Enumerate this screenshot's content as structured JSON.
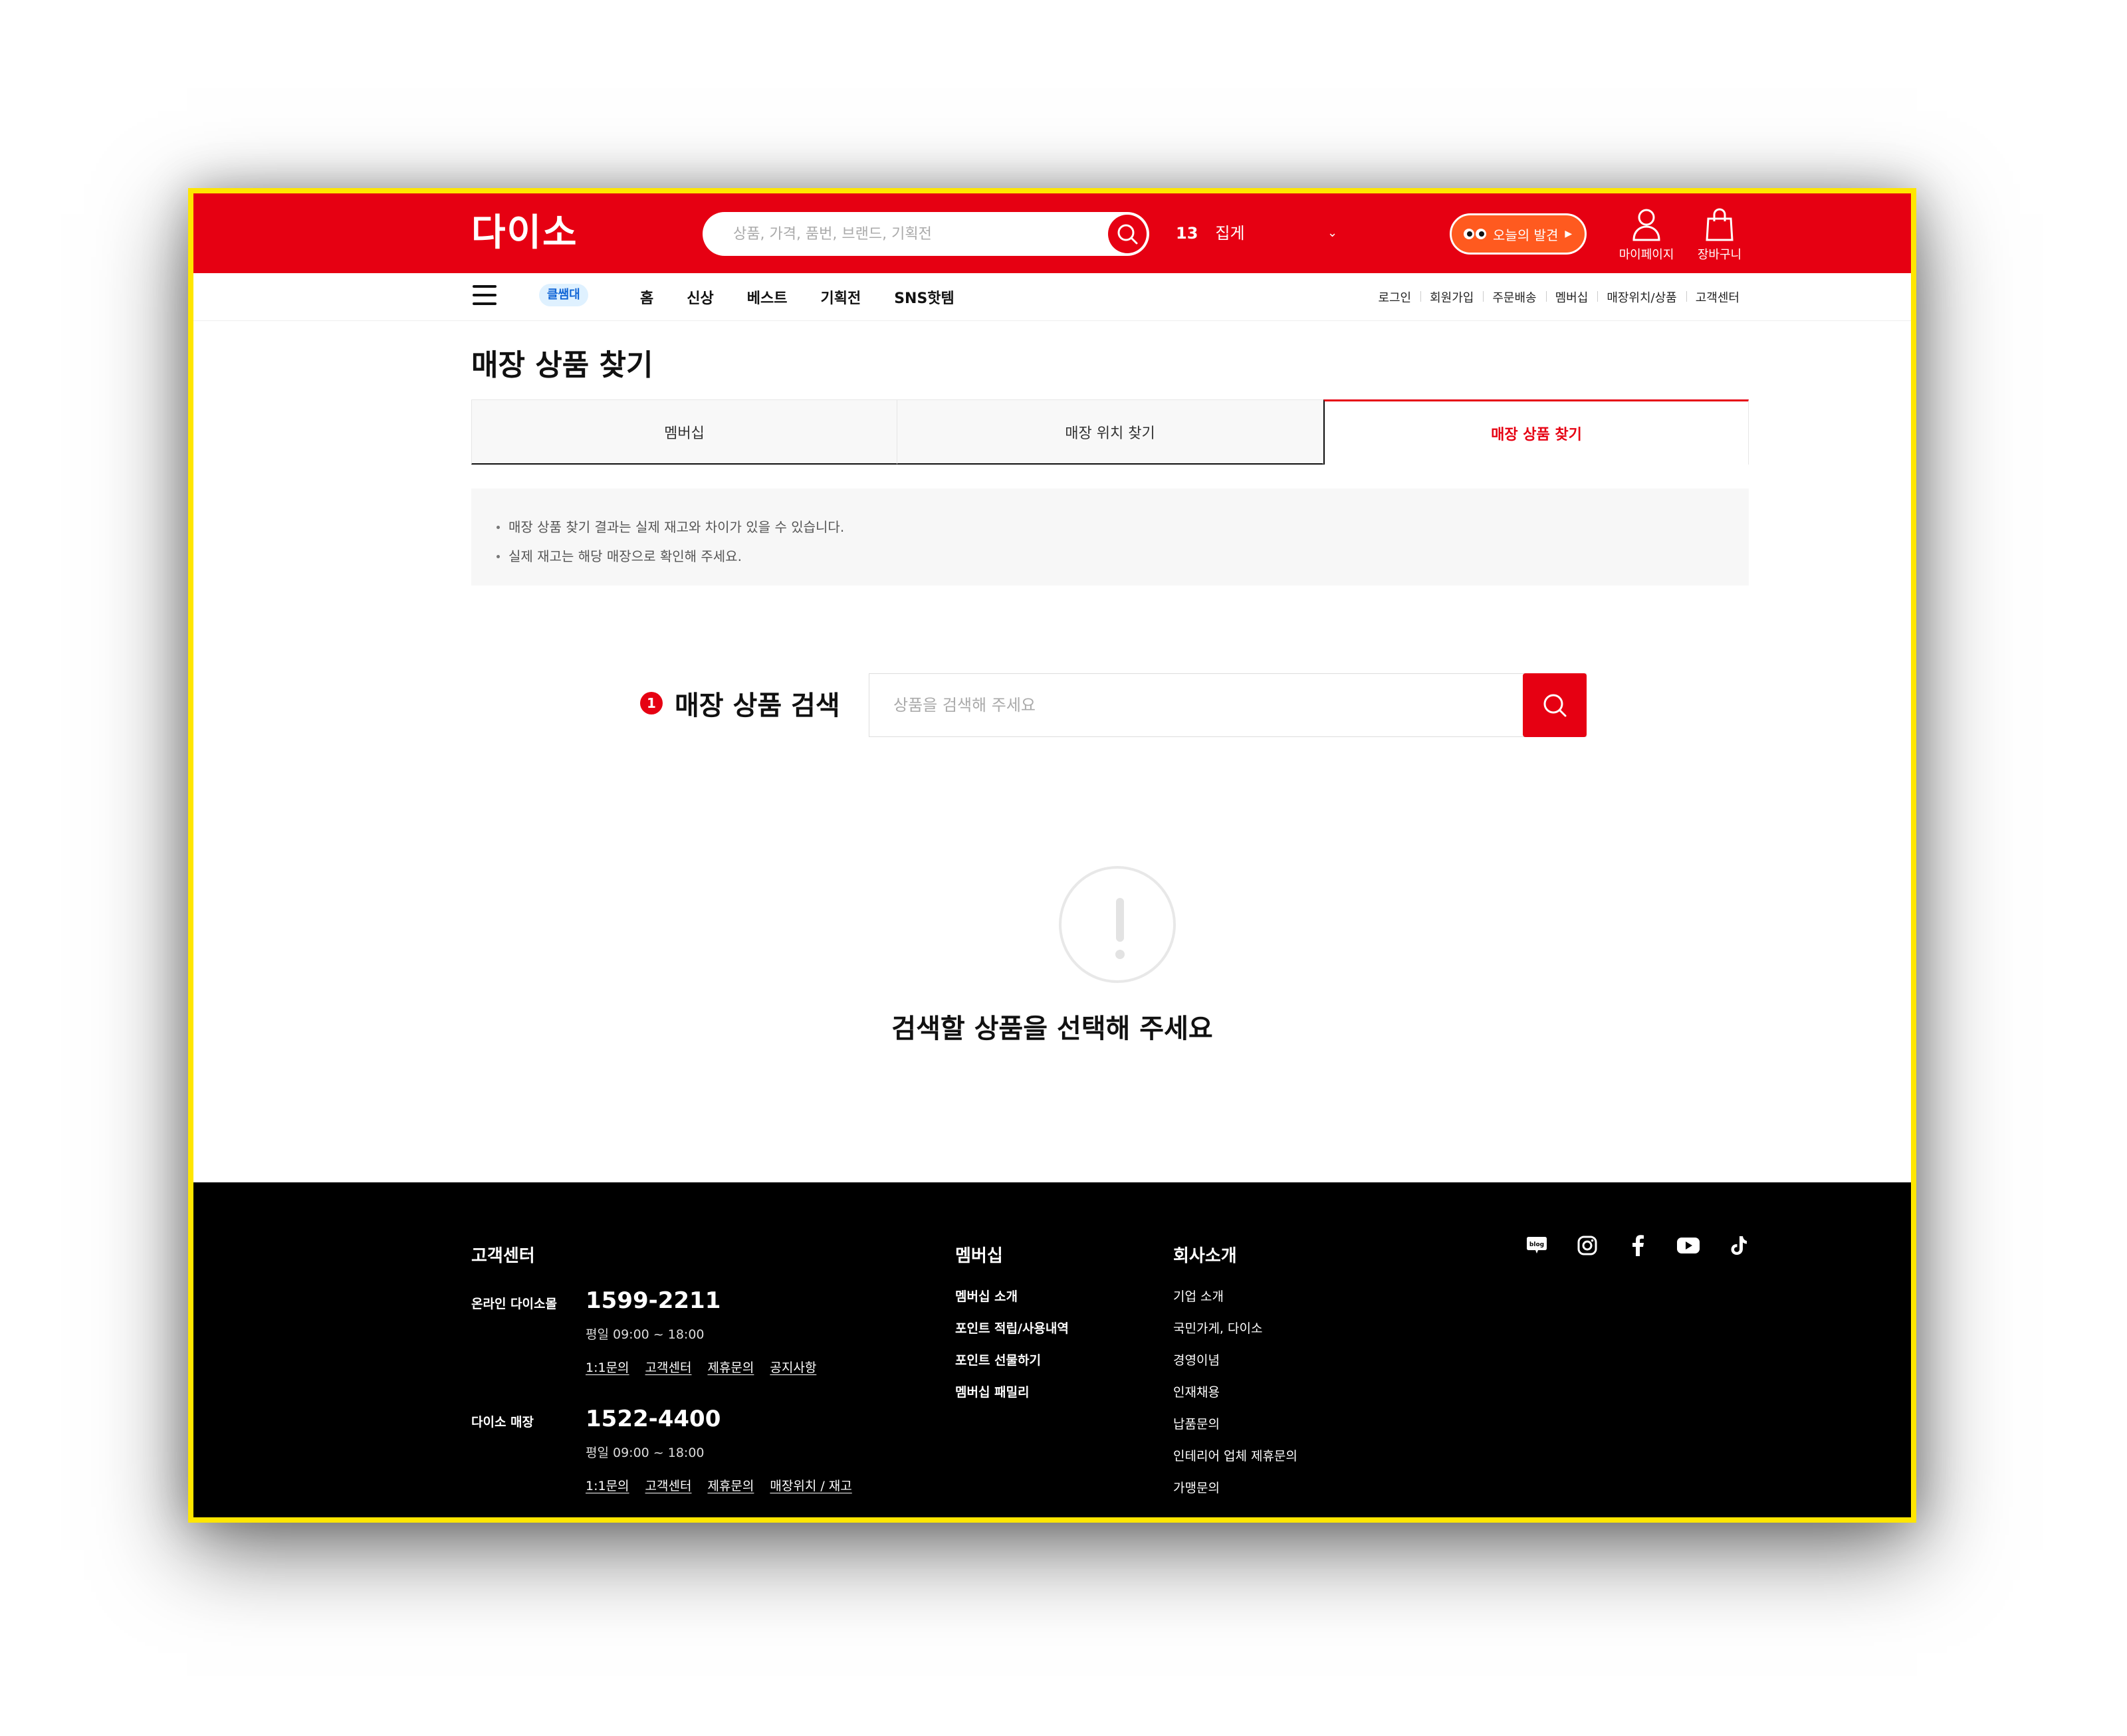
{
  "header": {
    "logo": "다이소",
    "search_placeholder": "상품, 가격, 품번, 브랜드, 기획전",
    "ranking": {
      "rank": "13",
      "term": "집게"
    },
    "promo_label": "오늘의 발견",
    "mypage_label": "마이페이지",
    "cart_label": "장바구니",
    "brand_color": "#e60012"
  },
  "nav": {
    "badge": "클쌤대",
    "items": [
      "홈",
      "신상",
      "베스트",
      "기획전",
      "SNS핫템"
    ],
    "util_items": [
      "로그인",
      "회원가입",
      "주문배송",
      "멤버십",
      "매장위치/상품",
      "고객센터"
    ]
  },
  "page": {
    "title": "매장 상품 찾기",
    "tabs": [
      "멤버십",
      "매장 위치 찾기",
      "매장 상품 찾기"
    ],
    "active_tab": "매장 상품 찾기",
    "notices": [
      "매장 상품 찾기 결과는 실제 재고와 차이가 있을 수 있습니다.",
      "실제 재고는 해당 매장으로 확인해 주세요."
    ],
    "step_number": "1",
    "step_label": "매장 상품 검색",
    "product_search_placeholder": "상품을 검색해 주세요",
    "empty_message": "검색할 상품을 선택해 주세요"
  },
  "footer": {
    "cs_title": "고객센터",
    "online": {
      "label": "온라인 다이소몰",
      "phone": "1599-2211",
      "hours": "평일 09:00 ~ 18:00",
      "links": [
        "1:1문의",
        "고객센터",
        "제휴문의",
        "공지사항"
      ]
    },
    "store": {
      "label": "다이소 매장",
      "phone": "1522-4400",
      "hours": "평일 09:00 ~ 18:00",
      "links": [
        "1:1문의",
        "고객센터",
        "제휴문의",
        "매장위치 / 재고"
      ]
    },
    "membership": {
      "title": "멤버십",
      "items": [
        "멤버십 소개",
        "포인트 적립/사용내역",
        "포인트 선물하기",
        "멤버십 패밀리"
      ]
    },
    "company": {
      "title": "회사소개",
      "items": [
        "기업 소개",
        "국민가게, 다이소",
        "경영이념",
        "인재채용",
        "납품문의",
        "인테리어 업체 제휴문의",
        "가맹문의"
      ]
    },
    "social_icons": [
      "blog-icon",
      "instagram-icon",
      "facebook-icon",
      "youtube-icon",
      "tiktok-icon"
    ],
    "blog_label": "blog"
  }
}
